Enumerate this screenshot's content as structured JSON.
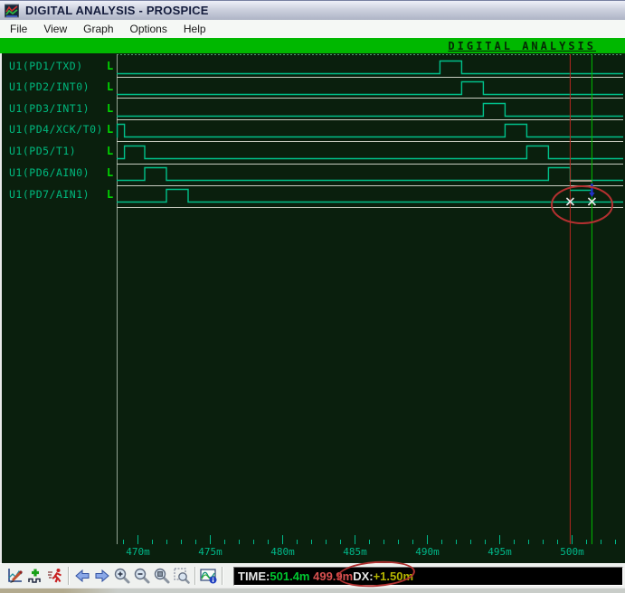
{
  "window": {
    "title": "DIGITAL ANALYSIS - PROSPICE"
  },
  "menu": {
    "items": [
      "File",
      "View",
      "Graph",
      "Options",
      "Help"
    ]
  },
  "banner": {
    "text": "DIGITAL ANALYSIS"
  },
  "colors": {
    "plot_bg": "#0A1F0D",
    "banner_bg": "#00B800",
    "trace": "#00C08A",
    "label": "#00B87E",
    "level": "#00D800",
    "tick": "#00B88A",
    "separator": "#C8CCC0",
    "cursor_ref": "#B42820",
    "cursor_cur": "#00BE00",
    "measure_bar": "#A89E8E",
    "measure_arrow": "#2030C8",
    "marker": "#E8E8E8",
    "annotation": "#B43030",
    "status_time": "#00C830",
    "status_ref": "#D85050",
    "status_dx": "#B4B400"
  },
  "chart_data": {
    "type": "digital-timing",
    "title": "DIGITAL ANALYSIS",
    "x_unit": "m",
    "x_minor_range": [
      469,
      503
    ],
    "x_ticks": [
      {
        "t": 470,
        "label": "470m"
      },
      {
        "t": 475,
        "label": "475m"
      },
      {
        "t": 480,
        "label": "480m"
      },
      {
        "t": 485,
        "label": "485m"
      },
      {
        "t": 490,
        "label": "490m"
      },
      {
        "t": 495,
        "label": "495m"
      },
      {
        "t": 500,
        "label": "500m"
      }
    ],
    "signals": [
      {
        "name": "U1(PD1/TXD)",
        "level": "L",
        "pulses_m": [
          [
            490.9,
            492.4
          ]
        ]
      },
      {
        "name": "U1(PD2/INT0)",
        "level": "L",
        "pulses_m": [
          [
            492.4,
            493.9
          ]
        ]
      },
      {
        "name": "U1(PD3/INT1)",
        "level": "L",
        "pulses_m": [
          [
            493.9,
            495.4
          ]
        ]
      },
      {
        "name": "U1(PD4/XCK/T0)",
        "level": "L",
        "pulses_m": [
          [
            468.6,
            469.1
          ],
          [
            495.4,
            496.9
          ]
        ]
      },
      {
        "name": "U1(PD5/T1)",
        "level": "L",
        "pulses_m": [
          [
            469.1,
            470.5
          ],
          [
            496.9,
            498.4
          ]
        ]
      },
      {
        "name": "U1(PD6/AIN0)",
        "level": "L",
        "pulses_m": [
          [
            470.5,
            472.0
          ],
          [
            498.4,
            499.9
          ]
        ]
      },
      {
        "name": "U1(PD7/AIN1)",
        "level": "L",
        "pulses_m": [
          [
            472.0,
            473.5
          ]
        ]
      }
    ],
    "cursors": {
      "reference_m": 499.9,
      "current_m": 501.4,
      "dx_m": 1.5
    }
  },
  "toolbar": {
    "buttons": [
      "edit-graph",
      "add-trace",
      "simulate",
      "pan-left",
      "pan-right",
      "zoom-in",
      "zoom-out",
      "zoom-fit",
      "zoom-area",
      "graph-info"
    ]
  },
  "status": {
    "time_label": "TIME:",
    "time_value": "501.4m",
    "gap": " ",
    "ref_value": "499.9m",
    "dx_label": "DX:",
    "dx_value": "+1.50m"
  }
}
